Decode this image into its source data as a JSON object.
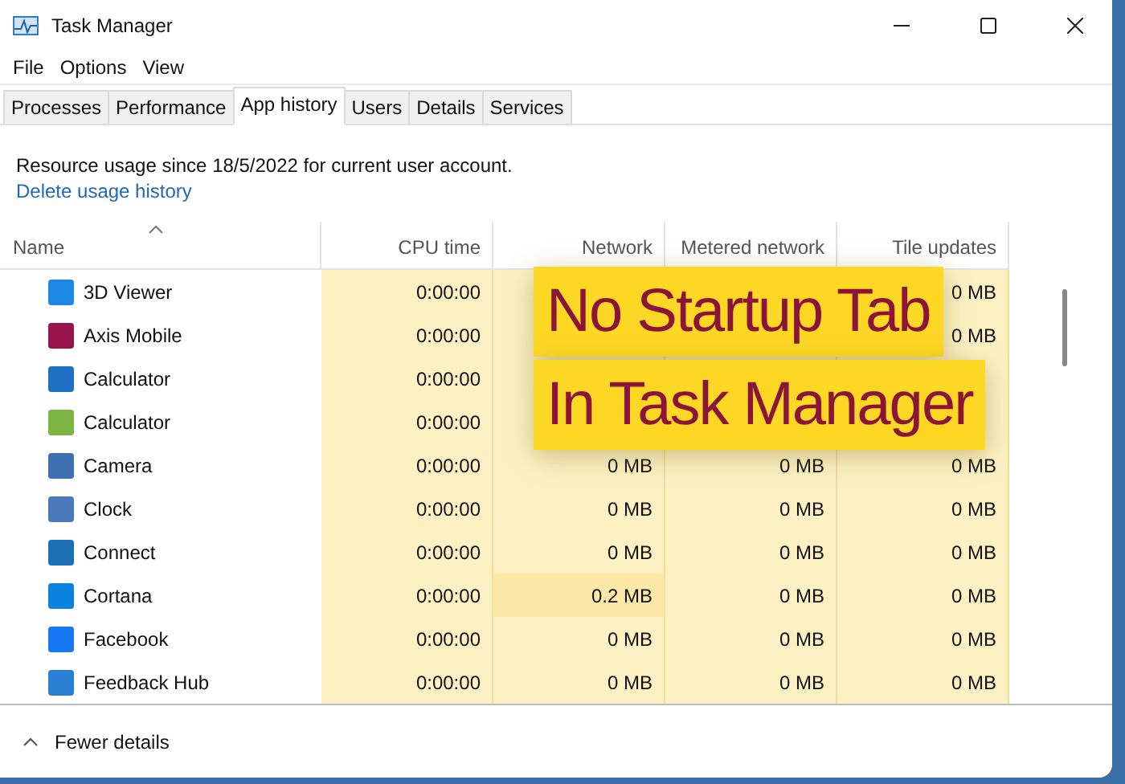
{
  "window": {
    "title": "Task Manager"
  },
  "menu": [
    "File",
    "Options",
    "View"
  ],
  "tabs": [
    {
      "label": "Processes",
      "selected": false
    },
    {
      "label": "Performance",
      "selected": false
    },
    {
      "label": "App history",
      "selected": true
    },
    {
      "label": "Users",
      "selected": false
    },
    {
      "label": "Details",
      "selected": false
    },
    {
      "label": "Services",
      "selected": false
    }
  ],
  "info": "Resource usage since 18/5/2022 for current user account.",
  "link": "Delete usage history",
  "table": {
    "columns": [
      "Name",
      "CPU time",
      "Network",
      "Metered network",
      "Tile updates"
    ],
    "rows": [
      {
        "name": "3D Viewer",
        "color": "#1e88e5",
        "cpu": "0:00:00",
        "network": null,
        "metered": null,
        "tile": "0 MB",
        "network_high": false
      },
      {
        "name": "Axis Mobile",
        "color": "#97144d",
        "cpu": "0:00:00",
        "network": null,
        "metered": null,
        "tile": "0 MB",
        "network_high": false
      },
      {
        "name": "Calculator",
        "color": "#1f6fc5",
        "cpu": "0:00:00",
        "network": null,
        "metered": null,
        "tile": null,
        "network_high": false
      },
      {
        "name": "Calculator",
        "color": "#7cb342",
        "cpu": "0:00:00",
        "network": null,
        "metered": null,
        "tile": null,
        "network_high": false
      },
      {
        "name": "Camera",
        "color": "#3f6fb0",
        "cpu": "0:00:00",
        "network": "0 MB",
        "metered": "0 MB",
        "tile": "0 MB",
        "network_high": false
      },
      {
        "name": "Clock",
        "color": "#4a78b8",
        "cpu": "0:00:00",
        "network": "0 MB",
        "metered": "0 MB",
        "tile": "0 MB",
        "network_high": false
      },
      {
        "name": "Connect",
        "color": "#1b6fb5",
        "cpu": "0:00:00",
        "network": "0 MB",
        "metered": "0 MB",
        "tile": "0 MB",
        "network_high": false
      },
      {
        "name": "Cortana",
        "color": "#0a84e0",
        "cpu": "0:00:00",
        "network": "0.2 MB",
        "metered": "0 MB",
        "tile": "0 MB",
        "network_high": true
      },
      {
        "name": "Facebook",
        "color": "#1877f2",
        "cpu": "0:00:00",
        "network": "0 MB",
        "metered": "0 MB",
        "tile": "0 MB",
        "network_high": false
      },
      {
        "name": "Feedback Hub",
        "color": "#2a7fd4",
        "cpu": "0:00:00",
        "network": "0 MB",
        "metered": "0 MB",
        "tile": "0 MB",
        "network_high": false
      }
    ]
  },
  "footer": "Fewer details",
  "caption": [
    "No Startup Tab",
    "In Task Manager"
  ]
}
